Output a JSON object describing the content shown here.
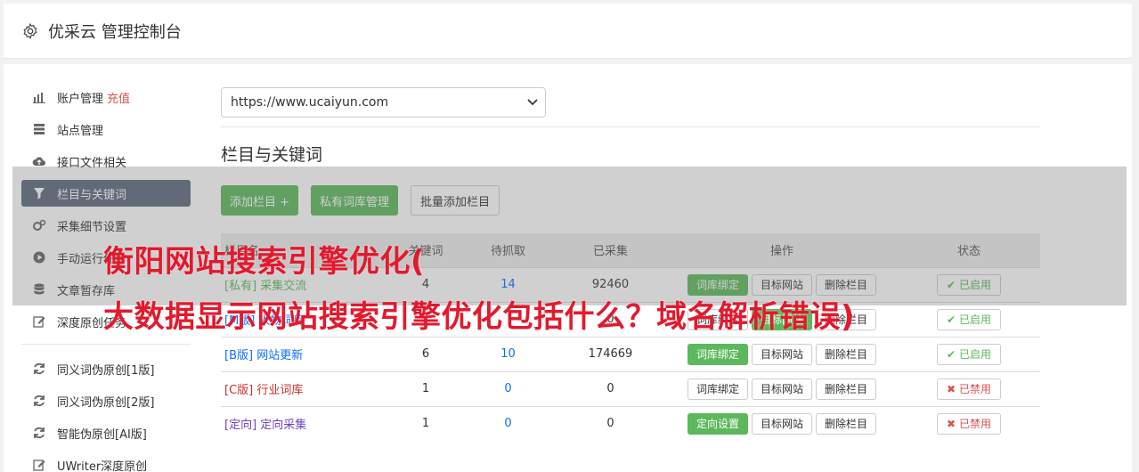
{
  "header": {
    "title": "优采云 管理控制台"
  },
  "sidebar": {
    "items": [
      {
        "label": "账户管理",
        "extra": "充值"
      },
      {
        "label": "站点管理"
      },
      {
        "label": "接口文件相关"
      },
      {
        "label": "栏目与关键词"
      },
      {
        "label": "采集细节设置"
      },
      {
        "label": "手动运行任务"
      },
      {
        "label": "文章暂存库"
      },
      {
        "label": "深度原创任务"
      },
      {
        "label": "同义词伪原创[1版]"
      },
      {
        "label": "同义词伪原创[2版]"
      },
      {
        "label": "智能伪原创[AI版]"
      },
      {
        "label": "UWriter深度原创"
      }
    ]
  },
  "main": {
    "site_select": "https://www.ucaiyun.com",
    "section_title": "栏目与关键词",
    "buttons": {
      "add_column": "添加栏目 +",
      "private_lib": "私有词库管理",
      "batch_add": "批量添加栏目"
    },
    "table": {
      "headers": [
        "栏目名",
        "关键词",
        "待抓取",
        "已采集",
        "操作",
        "状态"
      ],
      "rows": [
        {
          "tag": "[私有]",
          "name": "采集交流",
          "keywords": "4",
          "pending": "14",
          "collected": "92460",
          "op1": "词库绑定",
          "op2": "目标网站",
          "op3": "删除栏目",
          "status": "已启用"
        },
        {
          "tag": "[M版]",
          "name": "人物词库",
          "keywords": "",
          "pending": "",
          "collected": "0",
          "op1": "词库绑定",
          "op2": "目标网站",
          "op3": "删除栏目",
          "status": "已启用"
        },
        {
          "tag": "[B版]",
          "name": "网站更新",
          "keywords": "6",
          "pending": "10",
          "collected": "174669",
          "op1": "词库绑定",
          "op2": "目标网站",
          "op3": "删除栏目",
          "status": "已启用"
        },
        {
          "tag": "[C版]",
          "name": "行业词库",
          "keywords": "1",
          "pending": "0",
          "collected": "0",
          "op1": "词库绑定",
          "op2": "目标网站",
          "op3": "删除栏目",
          "status": "已禁用"
        },
        {
          "tag": "[定向]",
          "name": "定向采集",
          "keywords": "1",
          "pending": "0",
          "collected": "0",
          "op1": "定向设置",
          "op2": "目标网站",
          "op3": "删除栏目",
          "status": "已禁用"
        }
      ]
    }
  },
  "overlay": {
    "line1": "衡阳网站搜索引擎优化(",
    "line2": "大数据显示网站搜索引擎优化包括什么？域名解析错误)"
  },
  "colors": {
    "active_sidebar": "#5b6a7d",
    "green": "#5cb85c",
    "red": "#d9534f",
    "overlay_text": "#e3192d"
  }
}
